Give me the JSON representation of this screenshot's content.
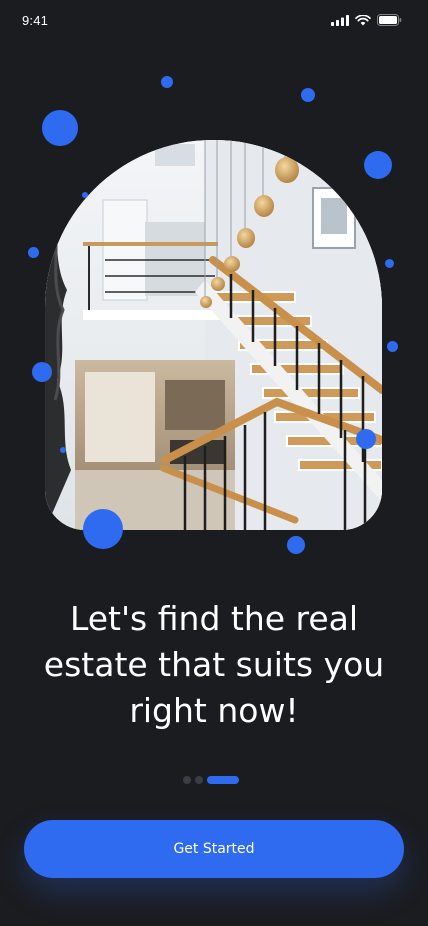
{
  "status_bar": {
    "time": "9:41",
    "icons": [
      "cellular-signal-icon",
      "wifi-icon",
      "battery-icon"
    ]
  },
  "onboarding": {
    "hero_image": "staircase-interior-photo",
    "headline": "Let's find the real estate that suits you right now!",
    "pagination": {
      "total": 3,
      "active_index": 2
    },
    "cta_label": "Get Started"
  },
  "colors": {
    "background": "#1b1c20",
    "accent": "#2f6bf0",
    "text": "#ffffff",
    "inactive_dot": "#3b3d44"
  }
}
